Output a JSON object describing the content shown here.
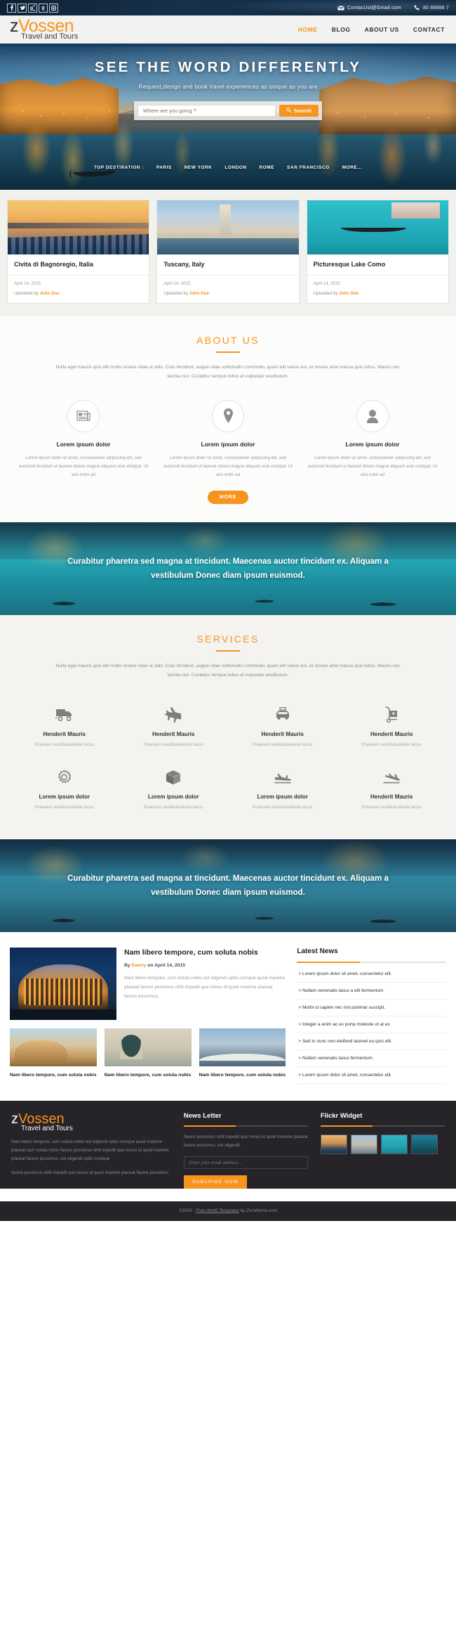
{
  "topbar": {
    "social": [
      {
        "name": "facebook-icon",
        "glyph": "f"
      },
      {
        "name": "twitter-icon",
        "glyph": "t"
      },
      {
        "name": "google-plus-icon",
        "glyph": "g"
      },
      {
        "name": "pinterest-icon",
        "glyph": "p"
      },
      {
        "name": "instagram-icon",
        "glyph": "i"
      }
    ],
    "email": "ContacUst@Gmail.com",
    "phone": "80 88888 7"
  },
  "brand": {
    "name_part1": "z",
    "name_part2": "Vossen",
    "tagline": "Travel and Tours"
  },
  "nav": [
    {
      "label": "HOME",
      "active": true
    },
    {
      "label": "BLOG",
      "active": false
    },
    {
      "label": "ABOUT US",
      "active": false
    },
    {
      "label": "CONTACT",
      "active": false
    }
  ],
  "hero": {
    "heading": "SEE THE WORD DIFFERENTLY",
    "subheading": "Request,design and book travel experiences as unique as you are",
    "search_placeholder": "Where are you going ?",
    "search_button": "Search",
    "top_destination_label": "TOP DESTINATION :",
    "destinations": [
      "PARIS",
      "NEW YORK",
      "LONDON",
      "ROME",
      "SAN FRANCISCO",
      "MORE..."
    ]
  },
  "cards": [
    {
      "title": "Civita di Bagnoregio, Italia",
      "date": "April 14, 2015",
      "uploaded_prefix": "Uploaded by ",
      "author": "John Doe"
    },
    {
      "title": "Tuscany, Italy",
      "date": "April 14, 2015",
      "uploaded_prefix": "Uploaded by ",
      "author": "John Doe"
    },
    {
      "title": "Picturesque Lake Como",
      "date": "April 14, 2015",
      "uploaded_prefix": "Uploaded by ",
      "author": "John Doe"
    }
  ],
  "about": {
    "title": "ABOUT US",
    "lead": "Nulla eget mauris quis elit mollis ornare vitae ut odio. Cras tincidunt, augue vitae sollicitudin commodo, quam elit varius est, et ornare ante massa quis tellus. Mauris nec lacinia nisl. Curabitur tempus tellus et vulputate vestibulum.",
    "columns": [
      {
        "icon": "newspaper-icon",
        "title": "Lorem ipsum dolor",
        "text": "Lorem ipsum dolor sit amet, consectetuer adipiscing elit, sed euismod tincidunt ut laoreet dolore magna aliquam erat volutpat. Ut wisi enim ad"
      },
      {
        "icon": "map-pin-icon",
        "title": "Lorem ipsum dolor",
        "text": "Lorem ipsum dolor sit amet, consectetuer adipiscing elit, sed euismod tincidunt ut laoreet dolore magna aliquam erat volutpat. Ut wisi enim ad"
      },
      {
        "icon": "user-icon",
        "title": "Lorem ipsum dolor",
        "text": "Lorem ipsum dolor sit amet, consectetuer adipiscing elit, sed euismod tincidunt ut laoreet dolore magna aliquam erat volutpat. Ut wisi enim ad"
      }
    ],
    "more_button": "MORE"
  },
  "banner1": {
    "text": "Curabitur pharetra sed magna at tincidunt. Maecenas auctor tincidunt ex. Aliquam a vestibulum Donec diam ipsum euismod."
  },
  "banner2": {
    "text": "Curabitur pharetra sed magna at tincidunt. Maecenas auctor tincidunt ex. Aliquam a vestibulum Donec diam ipsum euismod."
  },
  "services": {
    "title": "SERVICES",
    "lead": "Nulla eget mauris quis elit mollis ornare vitae ut odio. Cras tincidunt, augue vitae sollicitudin commodo, quam elit varius est, et ornare ante massa quis tellus. Mauris nec lacinia nisl. Curabitur tempus tellus et vulputate vestibulum.",
    "items": [
      {
        "icon": "truck-icon",
        "title": "Henderit Mauris",
        "text": "Praesent vestibuluolestie lacus"
      },
      {
        "icon": "airplane-icon",
        "title": "Henderit Mauris",
        "text": "Praesent vestibuluolestie lacus"
      },
      {
        "icon": "taxi-icon",
        "title": "Henderit Mauris",
        "text": "Praesent vestibuluolestie lacus"
      },
      {
        "icon": "hand-truck-icon",
        "title": "Henderit Mauris",
        "text": "Praesent vestibuluolestie lacus"
      },
      {
        "icon": "gear-icon",
        "title": "Lorem ipsum dolor",
        "text": "Praesent vestibuluolestie lacus"
      },
      {
        "icon": "box-icon",
        "title": "Lorem ipsum dolor",
        "text": "Praesent vestibuluolestie lacus"
      },
      {
        "icon": "plane-takeoff-icon",
        "title": "Lorem ipsum dolor",
        "text": "Praesent vestibuluolestie lacus"
      },
      {
        "icon": "plane-landing-icon",
        "title": "Henderit Mauris",
        "text": "Praesent vestibuluolestie lacus"
      }
    ]
  },
  "blog": {
    "post_title": "Nam libero tempore, cum soluta nobis",
    "meta_by": "By ",
    "meta_author": "Danny",
    "meta_date": " on April 14, 2015",
    "post_text": "Nam libero tempore, cum soluta nobis est eligendi optio cumque quod maxime placeat facere possimus nihil impedit quo minus id quod maxime placeat facere possimus.",
    "thumbs": [
      {
        "title": "Nam libero tempore, cum soluta nobis"
      },
      {
        "title": "Nam libero tempore, cum soluta nobis"
      },
      {
        "title": "Nam libero tempore, cum soluta nobis"
      }
    ],
    "latest_news_title": "Latest News",
    "latest_news": [
      "> Lorem ipsum dolor sit amet, consectetur elit.",
      "> Nullam venenatis lacus a elit fermentum.",
      "> Morbi ut sapien nec nisi pulvinar suscipit.",
      "> Integer a enim ac ex porta molestie ut at ex.",
      "> Sed in nunc non eleifend laoreet eu quis elit.",
      "> Nullam venenatis lacus fermentum.",
      "> Lorem ipsum dolor sit amet, consectetur elit."
    ]
  },
  "footer": {
    "about_text_1": "Nam libero tempore, cum soluta nobis est eligendi optio cumque quod maxime placeat cum soluta nobis facere possimus nihil impedit quo minus id quod maxime placeat facere possimus. est eligendi optio cumque",
    "about_text_2": "facere possimus nihil impedit quo minus id quod maxime placeat facere possimus.",
    "newsletter_title": "News Letter",
    "newsletter_text": "facere possimus nihil impedit quo minus id quod maxime placeat facere possimus. est eligendi",
    "newsletter_placeholder": "Enter your email address...",
    "newsletter_button": "SUBCRIBE NOW",
    "flickr_title": "Flickr Widget",
    "copyright_prefix": "©2015 - ",
    "copyright_link": "Free Html5 Templates",
    "copyright_suffix": " by Zerotheme.com"
  }
}
